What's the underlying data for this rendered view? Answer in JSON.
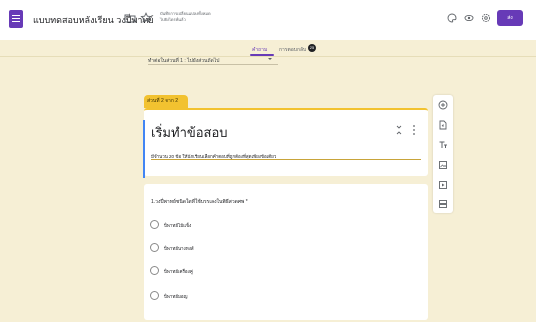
{
  "header": {
    "title": "แบบทดสอบหลังเรียน วงปี่พาทย์",
    "save_status_line1": "บันทึกการเปลี่ยนแปลงทั้งหมด",
    "save_status_line2": "ไปยังไดรฟ์แล้ว",
    "send_label": "ส่ง",
    "icons": [
      "folder-icon",
      "star-icon",
      "palette-icon",
      "preview-eye-icon",
      "settings-gear-icon"
    ]
  },
  "tabs": {
    "questions": "คำถาม",
    "responses": "การตอบกลับ",
    "responses_count": "25"
  },
  "goto": {
    "text": "ทำต่อในส่วนที่ 1 : ไปยังส่วนถัดไป"
  },
  "section": {
    "tag": "ส่วนที่ 2 จาก 2",
    "title": "เริ่มทำข้อสอบ",
    "description": "มีจำนวน 20 ข้อ ให้นักเรียนเลือกคำตอบที่ถูกต้องที่สุดเพียงข้อเดียว"
  },
  "question": {
    "text": "1.วงปี่พาทย์ชนิดใดที่ใช้บรรเลงในพิธีสวดศพ *",
    "options": [
      "ปี่พาทย์ไม้แข็ง",
      "ปี่พาทย์นางหงส์",
      "ปี่พาทย์เครื่องคู่",
      "ปี่พาทย์มอญ"
    ]
  },
  "side_toolbar": [
    "add-question-icon",
    "import-questions-icon",
    "add-title-icon",
    "add-image-icon",
    "add-video-icon",
    "add-section-icon"
  ],
  "colors": {
    "theme": "#673ab7",
    "background": "#f6efd5",
    "section_accent": "#f2c230",
    "focus_accent": "#4285f4"
  }
}
